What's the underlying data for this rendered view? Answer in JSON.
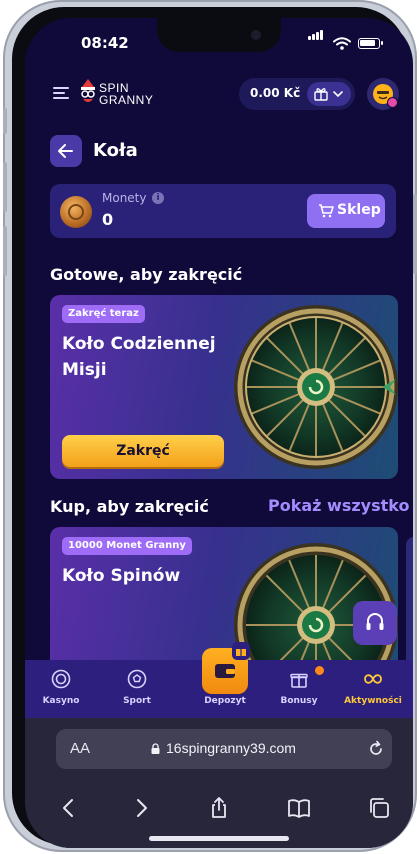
{
  "status_bar": {
    "time": "08:42"
  },
  "header": {
    "logo_line1": "SPIN",
    "logo_line2": "GRANNY",
    "balance": "0.00 Kč"
  },
  "page": {
    "title": "Koła"
  },
  "coins": {
    "label": "Monety",
    "value": "0",
    "shop_label": "Sklep"
  },
  "sections": {
    "ready_title": "Gotowe, aby zakręcić",
    "buy_title": "Kup, aby zakręcić",
    "show_all": "Pokaż wszystko"
  },
  "cards": [
    {
      "badge": "Zakręć teraz",
      "title": "Koło Codziennej Misji",
      "button": "Zakręć"
    },
    {
      "badge": "10000 Monet Granny",
      "title": "Koło Spinów"
    }
  ],
  "bottom_nav": {
    "items": [
      {
        "label": "Kasyno",
        "icon": "casino-chip-icon"
      },
      {
        "label": "Sport",
        "icon": "soccer-ball-icon"
      },
      {
        "label": "Depozyt",
        "icon": "wallet-icon"
      },
      {
        "label": "Bonusy",
        "icon": "gift-icon"
      },
      {
        "label": "Aktywności",
        "icon": "infinity-icon"
      }
    ],
    "active": "Aktywności"
  },
  "browser": {
    "aa_label": "AA",
    "url": "16spingranny39.com"
  },
  "colors": {
    "background": "#100a3a",
    "accent": "#8f6ff2",
    "spin_button": "#f4a01a",
    "active_nav": "#ffc83a",
    "nav_bar": "#2c1f7e"
  }
}
